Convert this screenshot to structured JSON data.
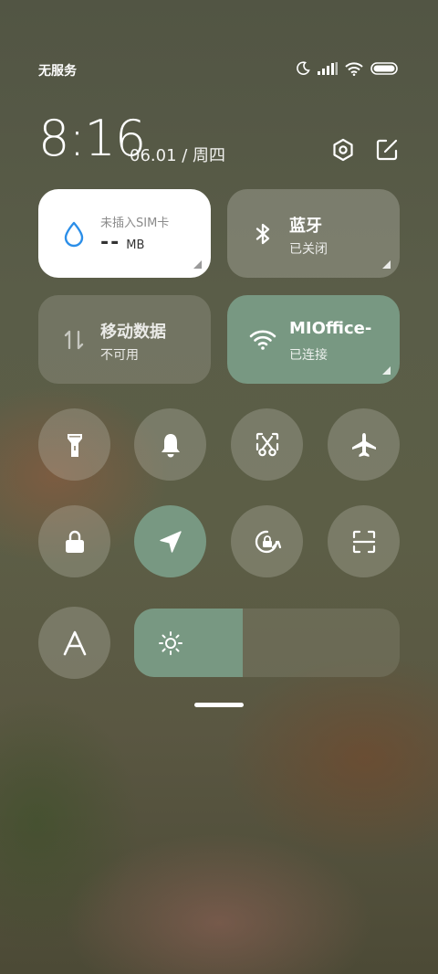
{
  "status_bar": {
    "carrier": "无服务",
    "icons": [
      "moon-icon",
      "signal-icon",
      "wifi-icon",
      "battery-icon"
    ]
  },
  "header": {
    "time": "8:16",
    "date": "06.01 / 周四",
    "icons": [
      "settings-hexagon-icon",
      "edit-icon"
    ]
  },
  "tiles": {
    "sim": {
      "title": "未插入SIM卡",
      "value": "--",
      "unit": "MB",
      "icon": "water-drop-icon"
    },
    "bluetooth": {
      "title": "蓝牙",
      "status": "已关闭",
      "icon": "bluetooth-icon"
    },
    "mobile_data": {
      "title": "移动数据",
      "status": "不可用",
      "icon": "data-arrows-icon"
    },
    "wifi": {
      "title": "MIOffice-",
      "status": "已连接",
      "icon": "wifi-icon"
    }
  },
  "toggles": [
    {
      "name": "flashlight",
      "icon": "flashlight-icon",
      "on": false
    },
    {
      "name": "mute",
      "icon": "bell-icon",
      "on": false
    },
    {
      "name": "screenshot",
      "icon": "scissors-icon",
      "on": false
    },
    {
      "name": "airplane",
      "icon": "airplane-icon",
      "on": false
    },
    {
      "name": "lock-screen",
      "icon": "lock-icon",
      "on": false
    },
    {
      "name": "location",
      "icon": "location-arrow-icon",
      "on": true
    },
    {
      "name": "rotation-lock",
      "icon": "rotation-lock-icon",
      "on": false
    },
    {
      "name": "scanner",
      "icon": "scan-icon",
      "on": false
    },
    {
      "name": "auto-font",
      "icon": "font-a-icon",
      "label": "A",
      "on": false
    }
  ],
  "brightness": {
    "level": 0.41,
    "icon": "sun-icon"
  },
  "colors": {
    "accent": "#789882",
    "sim_drop": "#2b8ee8",
    "tile_white": "#ffffff"
  }
}
